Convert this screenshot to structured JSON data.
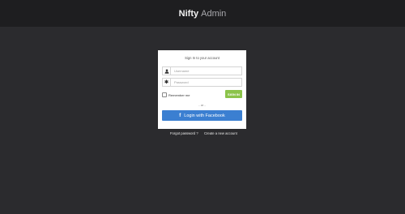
{
  "header": {
    "brand_main": "Nifty",
    "brand_sub": "Admin"
  },
  "login": {
    "title": "Sign In to your account",
    "username_placeholder": "Username",
    "password_placeholder": "Password",
    "remember_label": "Remember me",
    "signin_label": "SIGN IN",
    "or_text": "- or -",
    "facebook_label": "Login with Facebook",
    "facebook_icon": "f",
    "colors": {
      "signin": "#8bc34a",
      "facebook": "#3b7fd1"
    }
  },
  "footer_links": {
    "forgot": "Forgot password ?",
    "create": "Create a new account"
  }
}
